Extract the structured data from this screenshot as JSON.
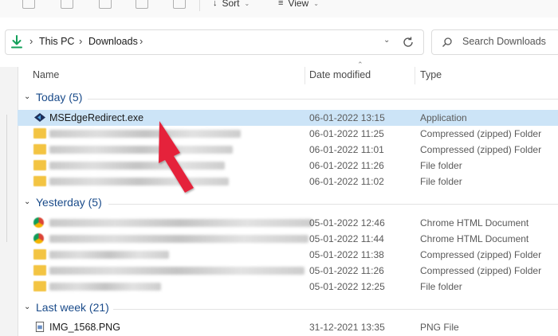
{
  "toolbar": {
    "sort_label": "Sort",
    "view_label": "View"
  },
  "address": {
    "crumbs": [
      "This PC",
      "Downloads"
    ],
    "search_placeholder": "Search Downloads"
  },
  "columns": {
    "name": "Name",
    "date": "Date modified",
    "type": "Type"
  },
  "groups": [
    {
      "title": "Today (5)",
      "rows": [
        {
          "name": "MSEdgeRedirect.exe",
          "date": "06-01-2022 13:15",
          "type": "Application",
          "icon": "app-icon",
          "selected": true
        },
        {
          "name": "",
          "date": "06-01-2022 11:25",
          "type": "Compressed (zipped) Folder",
          "icon": "zip-folder-icon"
        },
        {
          "name": "",
          "date": "06-01-2022 11:01",
          "type": "Compressed (zipped) Folder",
          "icon": "zip-folder-icon"
        },
        {
          "name": "",
          "date": "06-01-2022 11:26",
          "type": "File folder",
          "icon": "folder-icon"
        },
        {
          "name": "",
          "date": "06-01-2022 11:02",
          "type": "File folder",
          "icon": "folder-icon"
        }
      ]
    },
    {
      "title": "Yesterday (5)",
      "rows": [
        {
          "name": "",
          "date": "05-01-2022 12:46",
          "type": "Chrome HTML Document",
          "icon": "chrome-icon"
        },
        {
          "name": "",
          "date": "05-01-2022 11:44",
          "type": "Chrome HTML Document",
          "icon": "chrome-icon"
        },
        {
          "name": "",
          "date": "05-01-2022 11:38",
          "type": "Compressed (zipped) Folder",
          "icon": "zip-folder-icon"
        },
        {
          "name": "",
          "date": "05-01-2022 11:26",
          "type": "Compressed (zipped) Folder",
          "icon": "zip-folder-icon"
        },
        {
          "name": "",
          "date": "05-01-2022 12:25",
          "type": "File folder",
          "icon": "folder-icon"
        }
      ]
    },
    {
      "title": "Last week (21)",
      "rows": [
        {
          "name": "IMG_1568.PNG",
          "date": "31-12-2021 13:35",
          "type": "PNG File",
          "icon": "image-file-icon"
        }
      ]
    }
  ],
  "colors": {
    "selection": "#cce4f7",
    "group_title": "#1a4b8a",
    "arrow": "#e5243b",
    "download_icon": "#13a05a"
  }
}
